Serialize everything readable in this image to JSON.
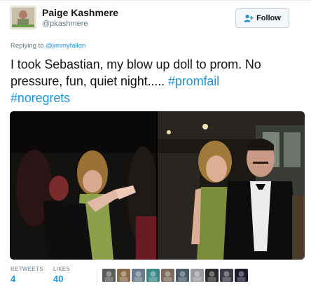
{
  "user": {
    "name": "Paige Kashmere",
    "handle": "@pkashmere"
  },
  "follow_label": "Follow",
  "reply": {
    "prefix": "Replying to ",
    "to": "@jimmyfallon"
  },
  "tweet": {
    "text": "I took Sebastian, my blow up doll to prom. No pressure, fun, quiet night..... ",
    "hashtags": [
      "#promfail",
      "#noregrets"
    ]
  },
  "stats": {
    "retweets_label": "RETWEETS",
    "retweets": "4",
    "likes_label": "LIKES",
    "likes": "40"
  },
  "liker_avatar_colors": [
    "#5a5a5a",
    "#8a6a4a",
    "#6a7a8a",
    "#3a8a8a",
    "#7a6a5a",
    "#4a5a6a",
    "#9a9aa0",
    "#2a2a2a",
    "#3a3a4a",
    "#1a1a2a"
  ],
  "colors": {
    "link": "#1b95e0",
    "text": "#14171a",
    "muted": "#657786"
  }
}
